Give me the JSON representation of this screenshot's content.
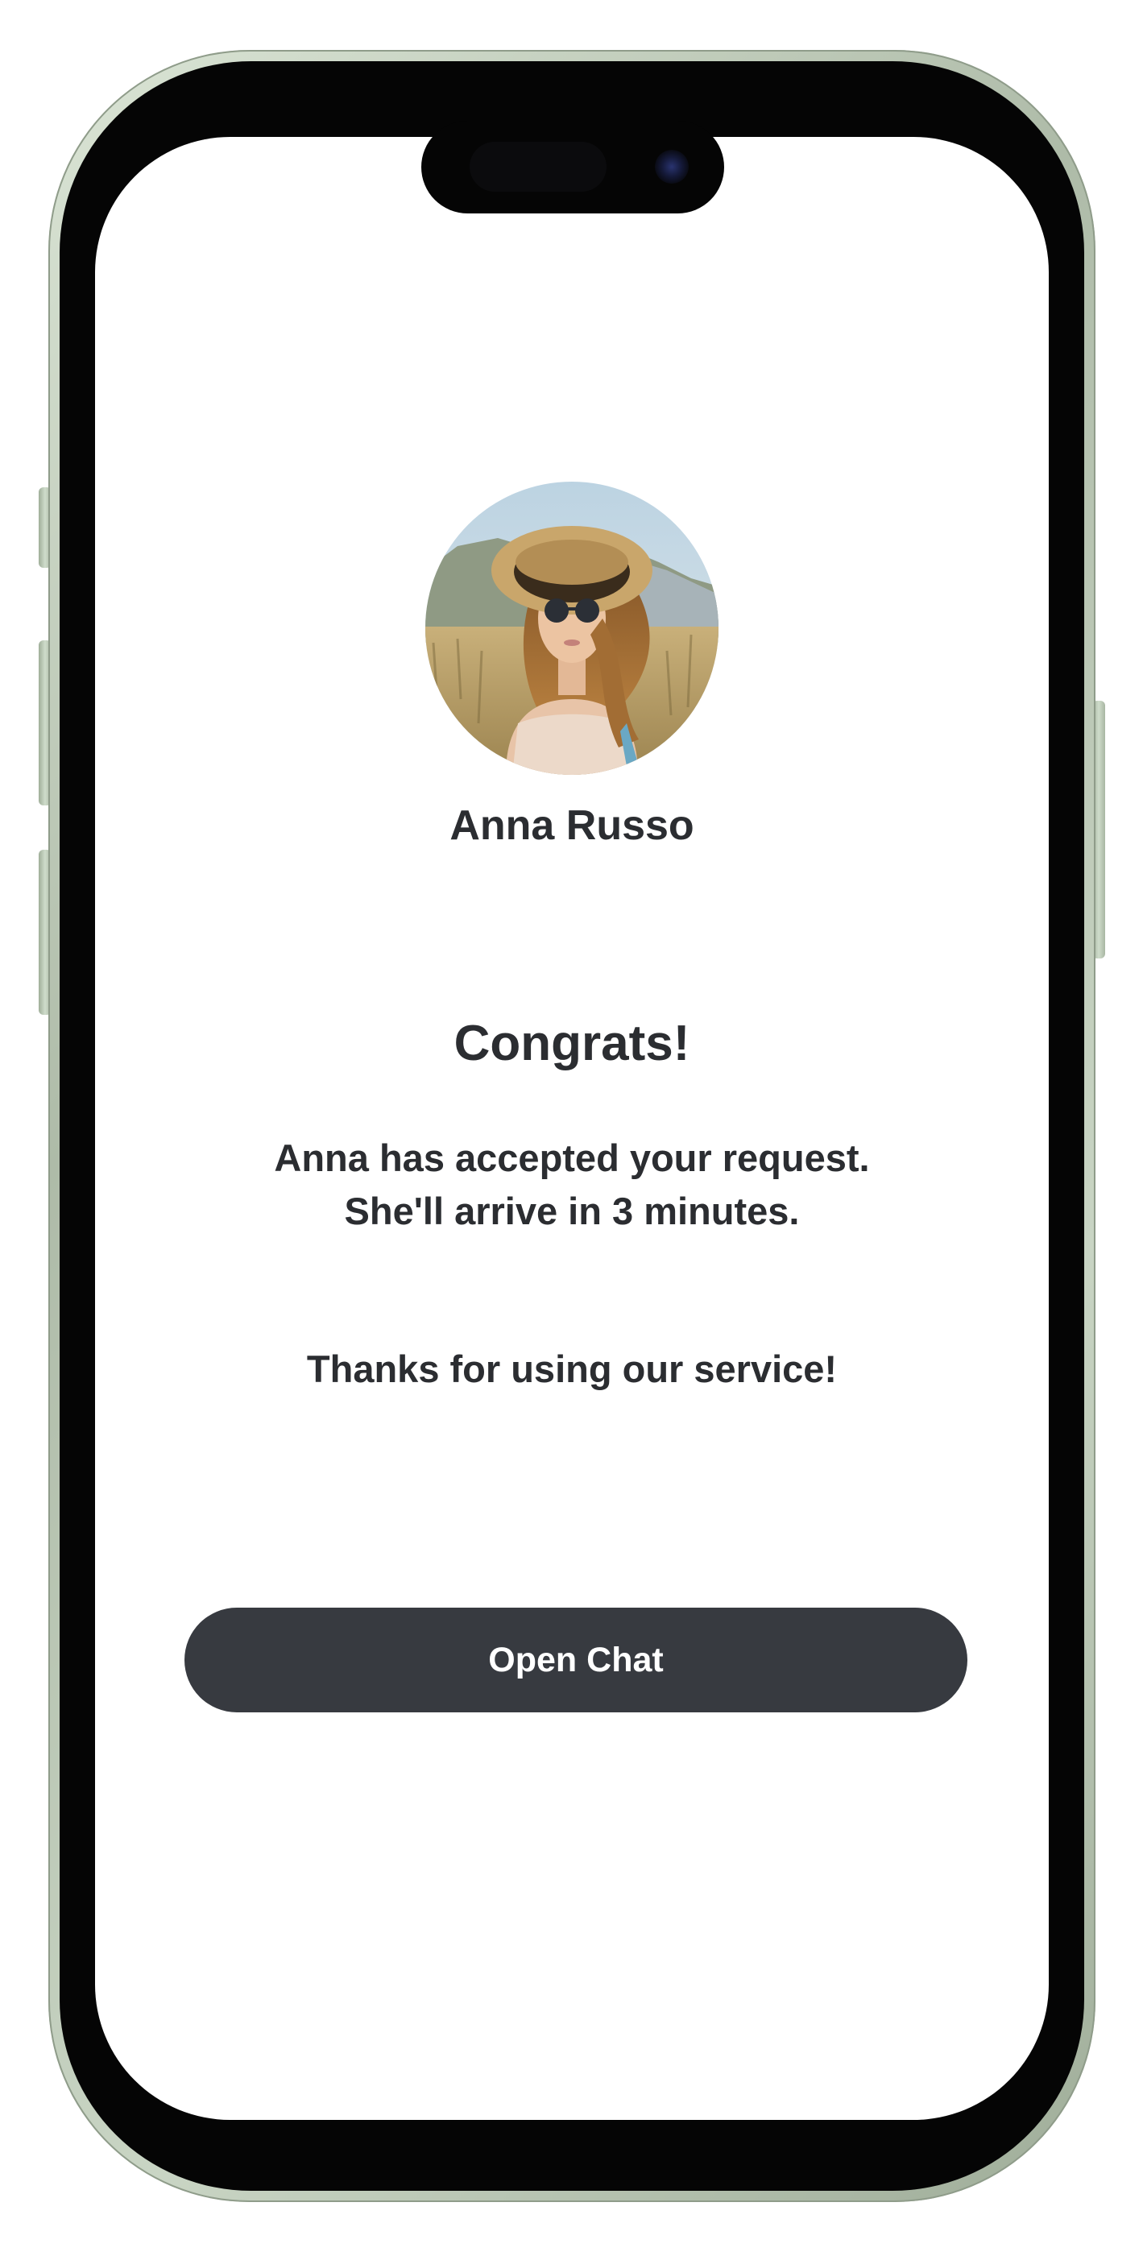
{
  "profile": {
    "name": "Anna Russo",
    "avatar_icon": "profile-photo"
  },
  "confirmation": {
    "title": "Congrats!",
    "message_line1": "Anna has accepted your request.",
    "message_line2": "She'll arrive in 3 minutes.",
    "thanks": "Thanks for using our service!"
  },
  "actions": {
    "open_chat_label": "Open Chat"
  },
  "colors": {
    "button_bg": "#373a40",
    "text": "#2b2d31",
    "frame": "#b8c6b3"
  }
}
